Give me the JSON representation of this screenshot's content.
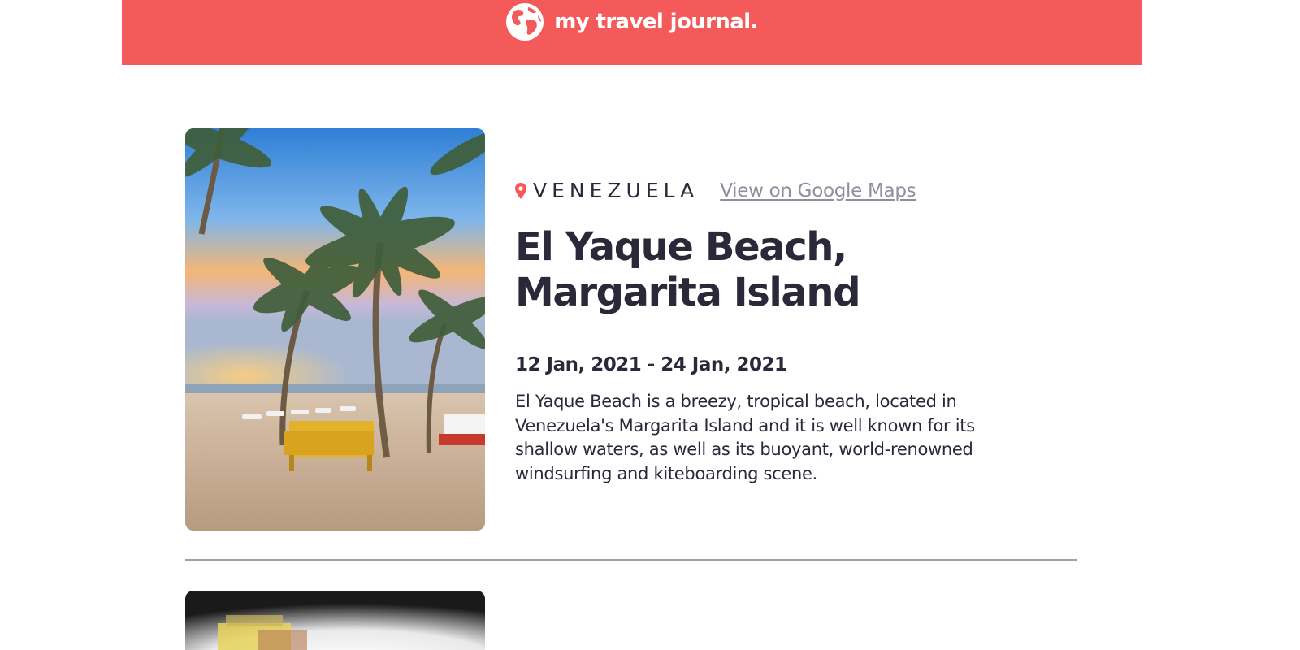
{
  "header": {
    "title": "my travel journal.",
    "icon": "globe-icon",
    "background_color": "#f55a5a"
  },
  "entries": [
    {
      "location_icon": "location-pin-icon",
      "country": "VENEZUELA",
      "maps_link_label": "View on Google Maps",
      "title": "El Yaque Beach, Margarita Island",
      "dates": "12 Jan, 2021 - 24 Jan, 2021",
      "description": "El Yaque Beach is a breezy, tropical beach, located in Venezuela's Margarita Island and it is well known for its shallow waters, as well as its buoyant, world-renowned windsurfing and kiteboarding scene.",
      "image": "beach-palm-trees-photo"
    },
    {
      "image": "next-entry-photo"
    }
  ],
  "colors": {
    "accent": "#f55a5a",
    "text": "#2b283a",
    "muted_link": "#918e9b",
    "divider": "#a0a0a0"
  }
}
